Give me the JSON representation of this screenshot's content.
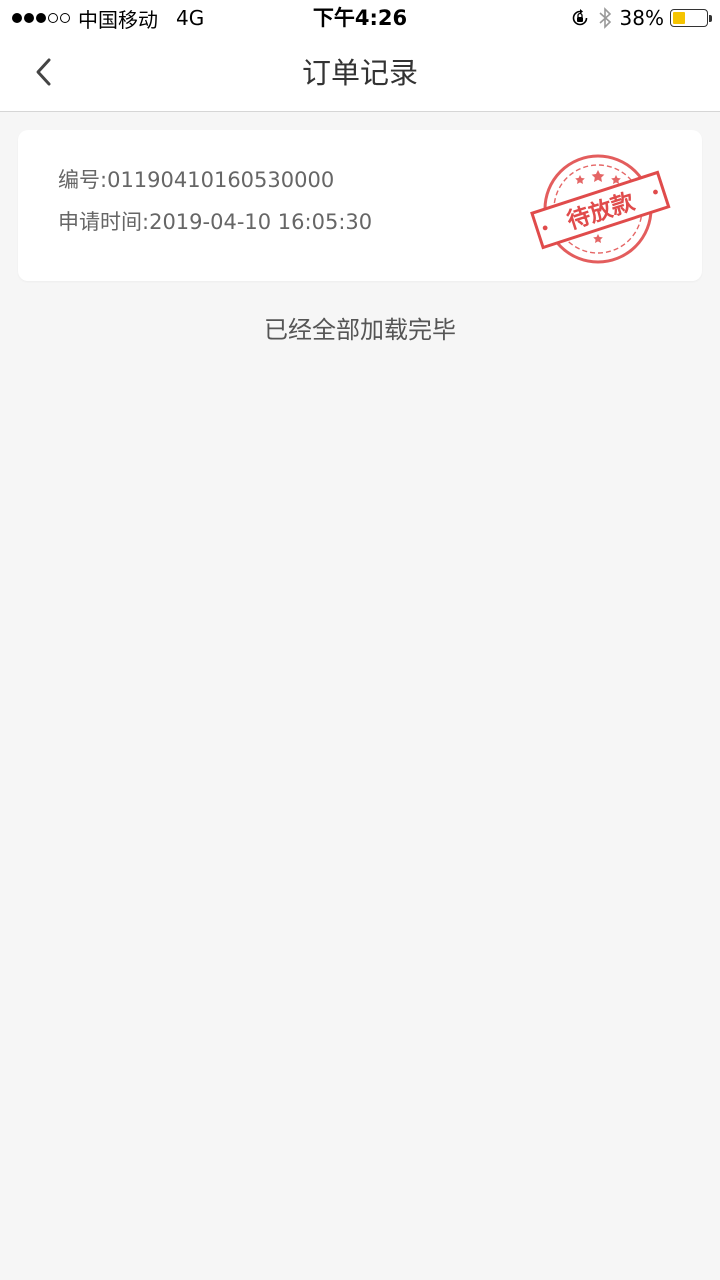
{
  "status_bar": {
    "carrier": "中国移动",
    "network": "4G",
    "time": "下午4:26",
    "battery_percent": "38%",
    "battery_level": 0.38,
    "signal_bars": 3,
    "signal_max": 5,
    "icons": [
      "rotation-lock-icon",
      "bluetooth-icon",
      "battery-icon"
    ]
  },
  "nav": {
    "title": "订单记录",
    "back_icon": "chevron-left-icon"
  },
  "orders": [
    {
      "number_label": "编号:",
      "number": "01190410160530000",
      "time_label": "申请时间:",
      "time": "2019-04-10 16:05:30",
      "status_stamp": "待放款",
      "stamp_color": "#e04b4b"
    }
  ],
  "footer": {
    "message": "已经全部加载完毕"
  },
  "colors": {
    "background": "#f6f6f6",
    "card": "#ffffff",
    "stamp_red": "#e04b4b",
    "battery_yellow": "#f5c400"
  }
}
